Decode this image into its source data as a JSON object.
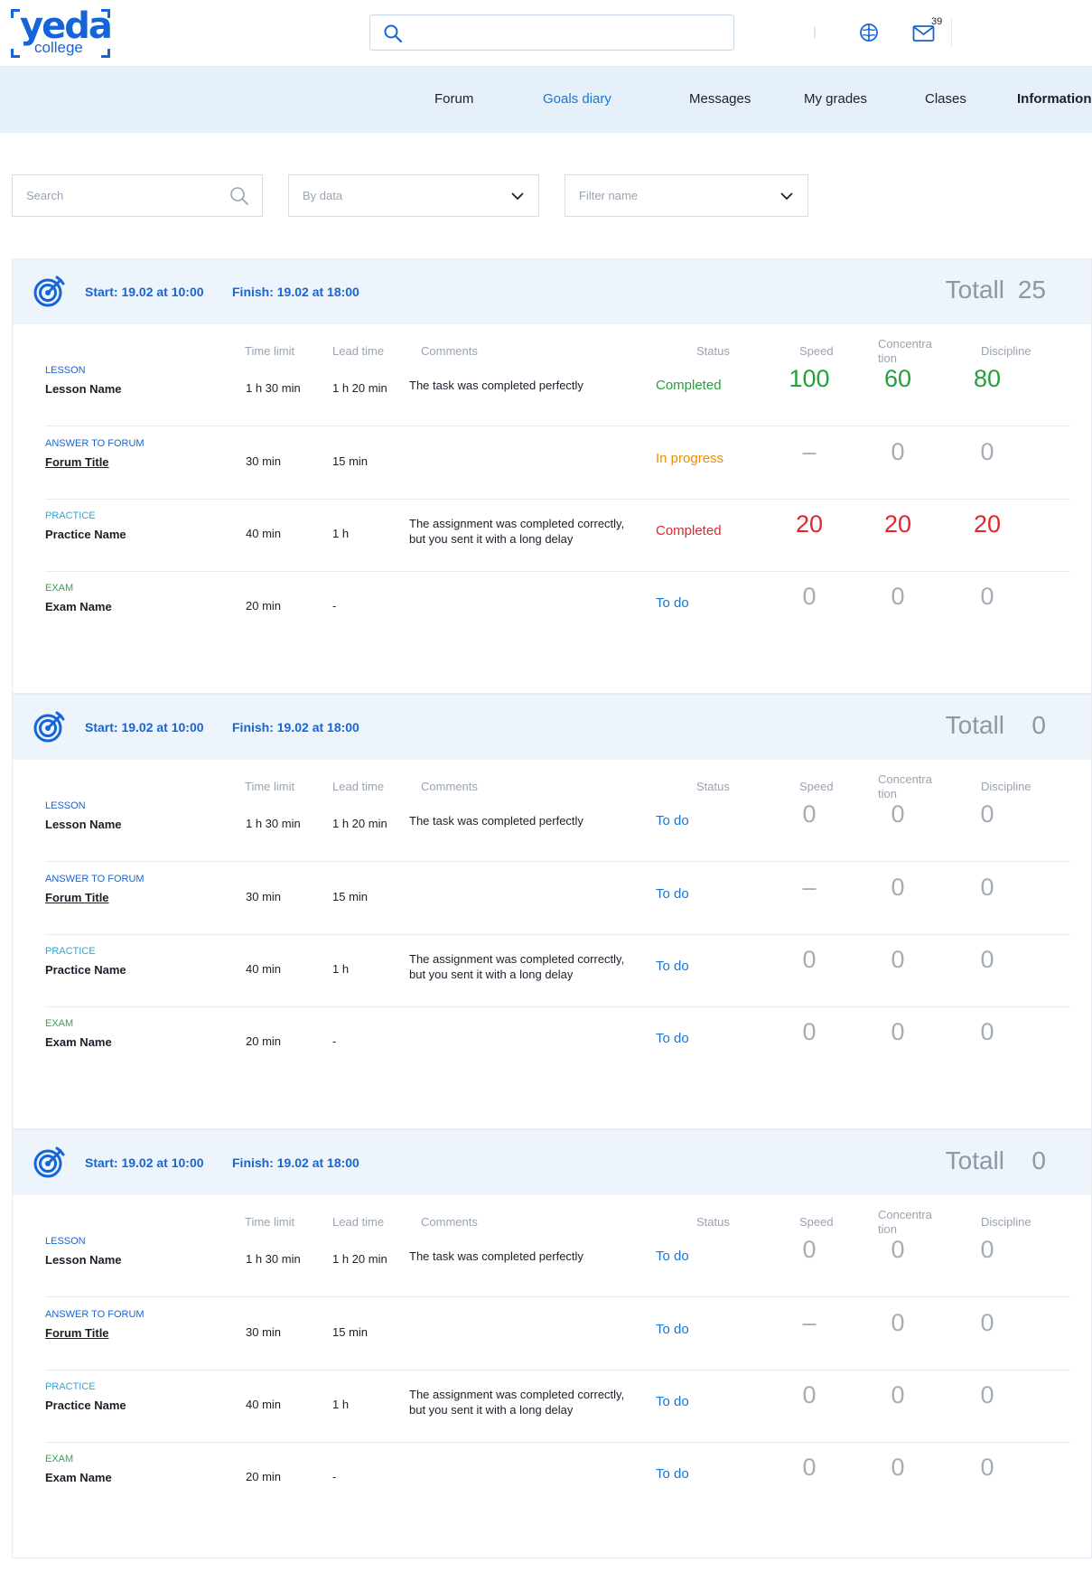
{
  "header": {
    "logo_main": "yeda",
    "logo_sub": "college",
    "mail_count": "39"
  },
  "nav": {
    "items": [
      {
        "label": "Forum"
      },
      {
        "label": "Goals diary"
      },
      {
        "label": "Messages"
      },
      {
        "label": "My grades"
      },
      {
        "label": "Clases"
      },
      {
        "label": "Information"
      }
    ],
    "active": "Goals diary"
  },
  "filters": {
    "search_placeholder": "Search",
    "by_data_placeholder": "By data",
    "filter_name_placeholder": "Filter name"
  },
  "columns": {
    "time_limit": "Time limit",
    "lead_time": "Lead time",
    "comments": "Comments",
    "status": "Status",
    "speed": "Speed",
    "concentration_1": "Concentra",
    "concentration_2": "tion",
    "discipline": "Discipline"
  },
  "goals": [
    {
      "start": "Start: 19.02 at 10:00",
      "finish": "Finish: 19.02 at 18:00",
      "total_label": "Totall",
      "total_value": "25",
      "rows": [
        {
          "type": "LESSON",
          "name": "Lesson Name",
          "time_limit": "1 h 30 min",
          "lead_time": "1 h 20 min",
          "comment_1": "The task was completed perfectly",
          "comment_2": "",
          "status": "Completed",
          "speed": "100",
          "concentration": "60",
          "discipline": "80"
        },
        {
          "type": "ANSWER TO FORUM",
          "name": "Forum Title",
          "time_limit": "30 min",
          "lead_time": "15 min",
          "comment_1": "",
          "comment_2": "",
          "status": "In progress",
          "speed": "–",
          "concentration": "0",
          "discipline": "0"
        },
        {
          "type": "PRACTICE",
          "name": "Practice Name",
          "time_limit": "40 min",
          "lead_time": "1 h",
          "comment_1": "The assignment was completed correctly,",
          "comment_2": "but you sent it with a long delay",
          "status": "Completed",
          "speed": "20",
          "concentration": "20",
          "discipline": "20"
        },
        {
          "type": "EXAM",
          "name": "Exam Name",
          "time_limit": "20 min",
          "lead_time": "-",
          "comment_1": "",
          "comment_2": "",
          "status": "To do",
          "speed": "0",
          "concentration": "0",
          "discipline": "0"
        }
      ]
    },
    {
      "start": "Start: 19.02 at 10:00",
      "finish": "Finish: 19.02 at 18:00",
      "total_label": "Totall",
      "total_value": "0",
      "rows": [
        {
          "type": "LESSON",
          "name": "Lesson Name",
          "time_limit": "1 h 30 min",
          "lead_time": "1 h 20 min",
          "comment_1": "The task was completed perfectly",
          "comment_2": "",
          "status": "To do",
          "speed": "0",
          "concentration": "0",
          "discipline": "0"
        },
        {
          "type": "ANSWER TO FORUM",
          "name": "Forum Title",
          "time_limit": "30 min",
          "lead_time": "15 min",
          "comment_1": "",
          "comment_2": "",
          "status": "To do",
          "speed": "–",
          "concentration": "0",
          "discipline": "0"
        },
        {
          "type": "PRACTICE",
          "name": "Practice Name",
          "time_limit": "40 min",
          "lead_time": "1 h",
          "comment_1": "The assignment was completed correctly,",
          "comment_2": "but you sent it with a long delay",
          "status": "To do",
          "speed": "0",
          "concentration": "0",
          "discipline": "0"
        },
        {
          "type": "EXAM",
          "name": "Exam Name",
          "time_limit": "20 min",
          "lead_time": "-",
          "comment_1": "",
          "comment_2": "",
          "status": "To do",
          "speed": "0",
          "concentration": "0",
          "discipline": "0"
        }
      ]
    },
    {
      "start": "Start: 19.02 at 10:00",
      "finish": "Finish: 19.02 at 18:00",
      "total_label": "Totall",
      "total_value": "0",
      "rows": [
        {
          "type": "LESSON",
          "name": "Lesson Name",
          "time_limit": "1 h 30 min",
          "lead_time": "1 h 20 min",
          "comment_1": "The task was completed perfectly",
          "comment_2": "",
          "status": "To do",
          "speed": "0",
          "concentration": "0",
          "discipline": "0"
        },
        {
          "type": "ANSWER TO FORUM",
          "name": "Forum Title",
          "time_limit": "30 min",
          "lead_time": "15 min",
          "comment_1": "",
          "comment_2": "",
          "status": "To do",
          "speed": "–",
          "concentration": "0",
          "discipline": "0"
        },
        {
          "type": "PRACTICE",
          "name": "Practice Name",
          "time_limit": "40 min",
          "lead_time": "1 h",
          "comment_1": "The assignment was completed correctly,",
          "comment_2": "but you sent it with a long delay",
          "status": "To do",
          "speed": "0",
          "concentration": "0",
          "discipline": "0"
        },
        {
          "type": "EXAM",
          "name": "Exam Name",
          "time_limit": "20 min",
          "lead_time": "-",
          "comment_1": "",
          "comment_2": "",
          "status": "To do",
          "speed": "0",
          "concentration": "0",
          "discipline": "0"
        }
      ]
    }
  ]
}
